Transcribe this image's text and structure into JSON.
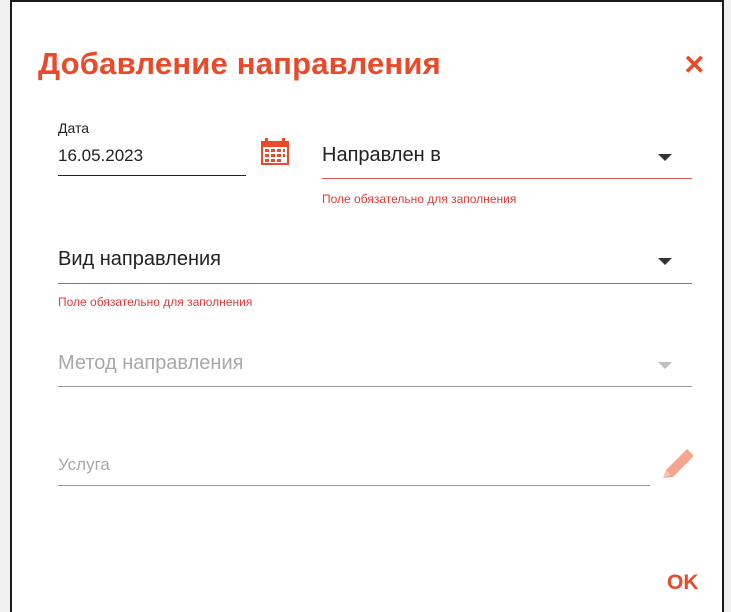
{
  "dialog": {
    "title": "Добавление направления",
    "close_symbol": "✕",
    "ok_label": "OK"
  },
  "date_field": {
    "label": "Дата",
    "value": "16.05.2023",
    "icon": "calendar-icon"
  },
  "directed_to": {
    "placeholder": "Направлен в",
    "error": "Поле обязательно для заполнения"
  },
  "direction_type": {
    "placeholder": "Вид направления",
    "error": "Поле обязательно для заполнения"
  },
  "direction_method": {
    "placeholder": "Метод направления"
  },
  "service": {
    "placeholder": "Услуга",
    "icon": "pencil-icon"
  },
  "colors": {
    "accent": "#e84a2a",
    "error": "#e03a3a"
  }
}
